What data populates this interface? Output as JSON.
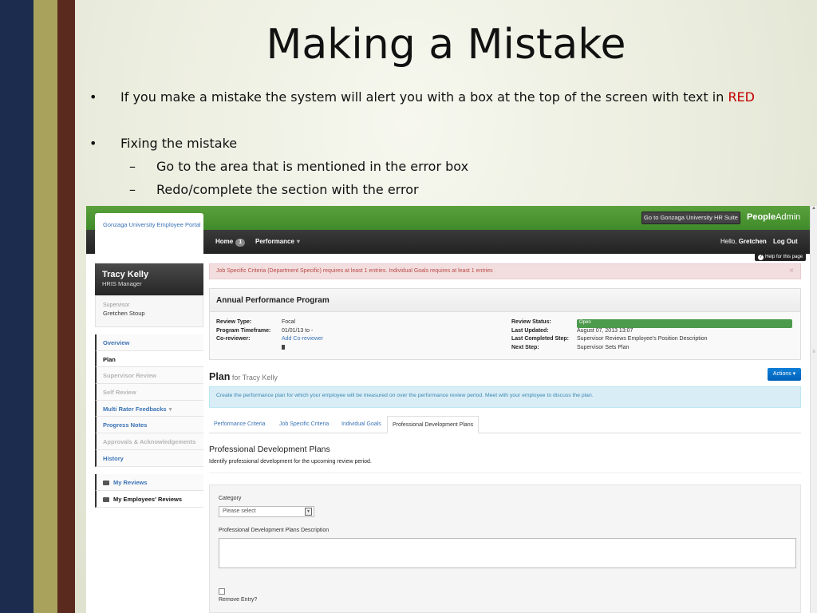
{
  "slide": {
    "title": "Making a Mistake",
    "bullet_mark": "•",
    "dash_mark": "–",
    "bullet1_text": "If you make a mistake the system will alert you with a box at the top of the screen with text in ",
    "bullet1_emph": "RED",
    "bullet2": "Fixing the mistake",
    "sub1": "Go to the area that is mentioned in the error box",
    "sub2": "Redo/complete the section with the error",
    "colors": {
      "navy": "#1c2c4e",
      "olive": "#a9a25d",
      "brown": "#5a2a1e",
      "red": "#c00000"
    }
  },
  "app": {
    "portal_tab": "Gonzaga University Employee Portal",
    "hr_suite_button": "Go to Gonzaga University HR Suite",
    "brand_bold": "People",
    "brand_rest": "Admin",
    "nav": {
      "home": "Home",
      "home_badge": "1",
      "performance": "Performance",
      "caret": "▾",
      "hello": "Hello, ",
      "user": "Gretchen",
      "logout": "Log Out"
    },
    "help": "Help for this page",
    "help_icon": "?",
    "sidebar": {
      "user_name": "Tracy Kelly",
      "user_role": "HRIS Manager",
      "supervisor_label": "Supervisor",
      "supervisor_name": "Gretchen Stoup",
      "items": [
        {
          "label": "Overview"
        },
        {
          "label": "Plan"
        },
        {
          "label": "Supervisor Review"
        },
        {
          "label": "Self Review"
        },
        {
          "label": "Multi Rater Feedbacks"
        },
        {
          "label": "Progress Notes"
        },
        {
          "label": "Approvals & Acknowledgements"
        },
        {
          "label": "History"
        }
      ],
      "reviews": [
        {
          "label": "My Reviews"
        },
        {
          "label": "My Employees' Reviews"
        }
      ]
    },
    "alert": {
      "text": "Job Specific Criteria (Department Specific) requires at least 1 entries. Individual Goals requires at least 1 entries",
      "close": "×"
    },
    "program": {
      "title": "Annual Performance Program",
      "left": [
        {
          "key": "Review Type:",
          "value": "Focal"
        },
        {
          "key": "Program Timeframe:",
          "value": "01/01/13 to -"
        },
        {
          "key": "Co-reviewer:",
          "value": "Add Co-reviewer"
        }
      ],
      "right": [
        {
          "key": "Review Status:",
          "value": "Open"
        },
        {
          "key": "Last Updated:",
          "value": "August 07, 2013 13:07"
        },
        {
          "key": "Last Completed Step:",
          "value": "Supervisor Reviews Employee's Position Description"
        },
        {
          "key": "Next Step:",
          "value": "Supervisor Sets Plan"
        }
      ],
      "status_color": "#4c9a4c"
    },
    "plan": {
      "title": "Plan",
      "for": " for Tracy Kelly",
      "actions": "Actions ▾"
    },
    "info": "Create the performance plan for which your employee will be measured on over the performance review period. Meet with your employee to discuss the plan.",
    "tabs": [
      {
        "label": "Performance Criteria"
      },
      {
        "label": "Job Specific Criteria"
      },
      {
        "label": "Individual Goals"
      },
      {
        "label": "Professional Development Plans"
      }
    ],
    "pdp": {
      "title": "Professional Development Plans",
      "subtitle": "Identify professional development for the upcoming review period.",
      "category_label": "Category",
      "category_value": "Please select",
      "description_label": "Professional Development Plans Description",
      "remove_label": "Remove Entry?"
    },
    "colors": {
      "topbar": "#4a9632",
      "navbar": "#2b2b2b",
      "link": "#3a73b5",
      "alert_text": "#b94a48",
      "alert_bg": "#f2dede",
      "info_bg": "#d9edf7",
      "actions": "#0a70cc"
    }
  }
}
